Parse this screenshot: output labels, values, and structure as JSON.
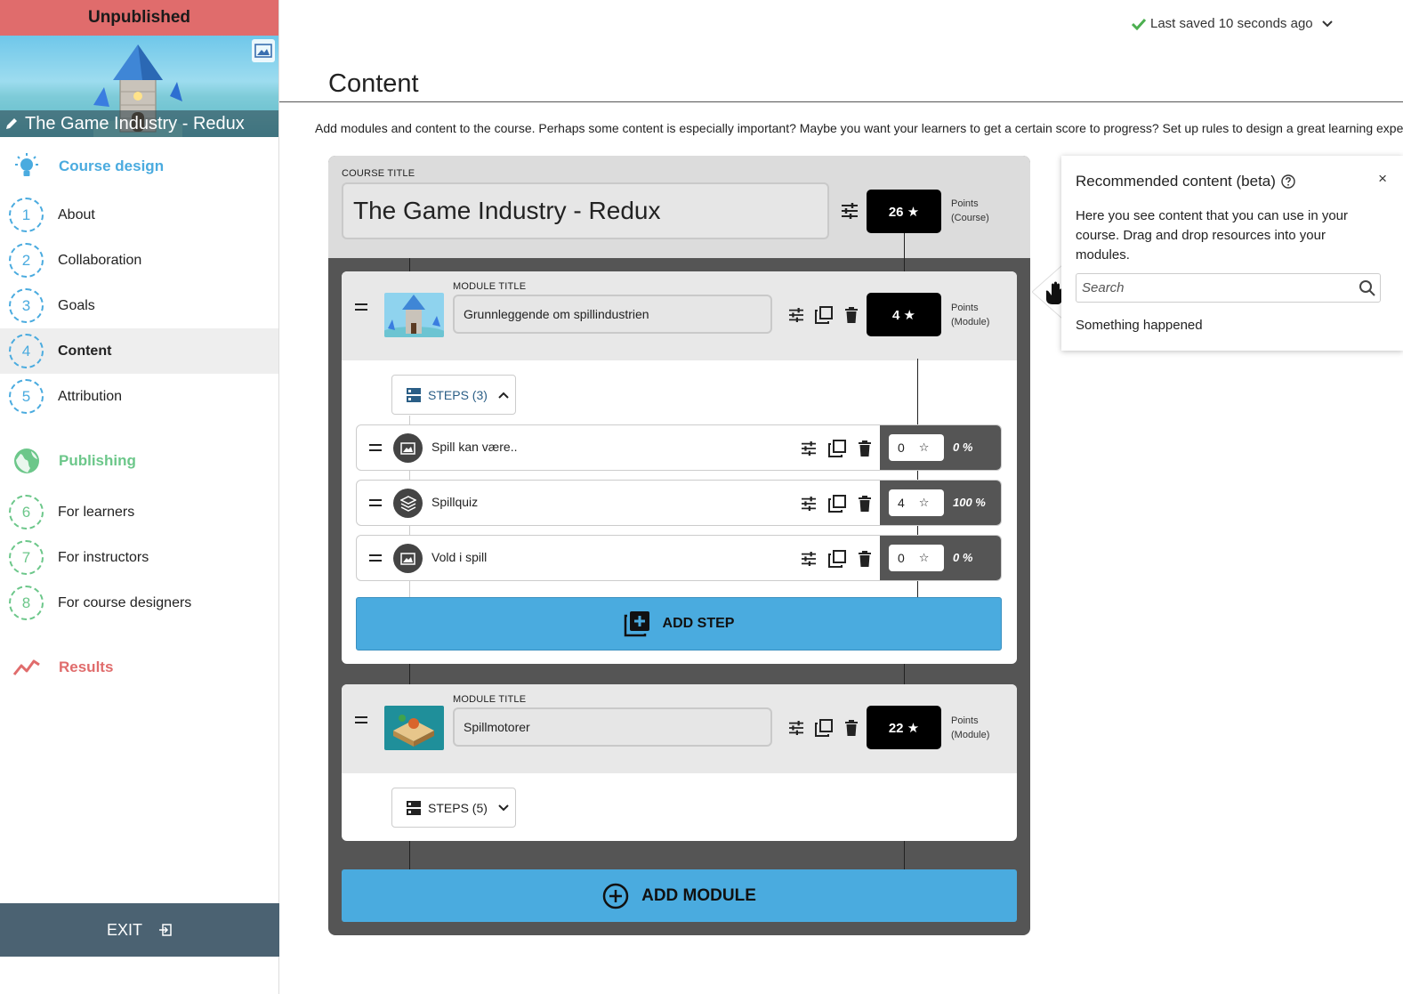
{
  "sidebar": {
    "status_banner": "Unpublished",
    "course_title": "The Game Industry - Redux",
    "course_design": "Course design",
    "design_items": [
      {
        "num": "1",
        "label": "About"
      },
      {
        "num": "2",
        "label": "Collaboration"
      },
      {
        "num": "3",
        "label": "Goals"
      },
      {
        "num": "4",
        "label": "Content"
      },
      {
        "num": "5",
        "label": "Attribution"
      }
    ],
    "publishing": "Publishing",
    "publishing_items": [
      {
        "num": "6",
        "label": "For learners"
      },
      {
        "num": "7",
        "label": "For instructors"
      },
      {
        "num": "8",
        "label": "For course designers"
      }
    ],
    "results": "Results",
    "exit": "EXIT"
  },
  "header": {
    "saved_status": "Last saved 10 seconds ago",
    "page_title": "Content",
    "intro": "Add modules and content to the course. Perhaps some content is especially important? Maybe you want your learners to get a certain score to progress? Set up rules to design a great learning experience"
  },
  "course": {
    "title_label": "COURSE TITLE",
    "title": "The Game Industry - Redux",
    "points": "26 ★",
    "points_caption_1": "Points",
    "points_caption_2": "(Course)"
  },
  "modules": [
    {
      "title_label": "MODULE TITLE",
      "title": "Grunnleggende om spillindustrien",
      "points": "4 ★",
      "points_caption_1": "Points",
      "points_caption_2": "(Module)",
      "steps_toggle": "STEPS (3)",
      "steps": [
        {
          "label": "Spill kan være..",
          "icon": "image-icon",
          "score": "0",
          "percent": "0 %"
        },
        {
          "label": "Spillquiz",
          "icon": "layers-icon",
          "score": "4",
          "percent": "100 %"
        },
        {
          "label": "Vold i spill",
          "icon": "image-icon",
          "score": "0",
          "percent": "0 %"
        }
      ],
      "add_step": "ADD STEP"
    },
    {
      "title_label": "MODULE TITLE",
      "title": "Spillmotorer",
      "points": "22 ★",
      "points_caption_1": "Points",
      "points_caption_2": "(Module)",
      "steps_toggle": "STEPS (5)"
    }
  ],
  "add_module": "ADD MODULE",
  "recommended": {
    "title": "Recommended content (beta)",
    "close": "×",
    "body": "Here you see content that you can use in your course. Drag and drop resources into your modules.",
    "search_placeholder": "Search",
    "status": "Something happened"
  },
  "colors": {
    "unpublished": "#e06c6c",
    "design_blue": "#4aabdf",
    "publishing_green": "#6cc78a",
    "results_red": "#e06c6c",
    "exit_bar": "#4b6272"
  }
}
